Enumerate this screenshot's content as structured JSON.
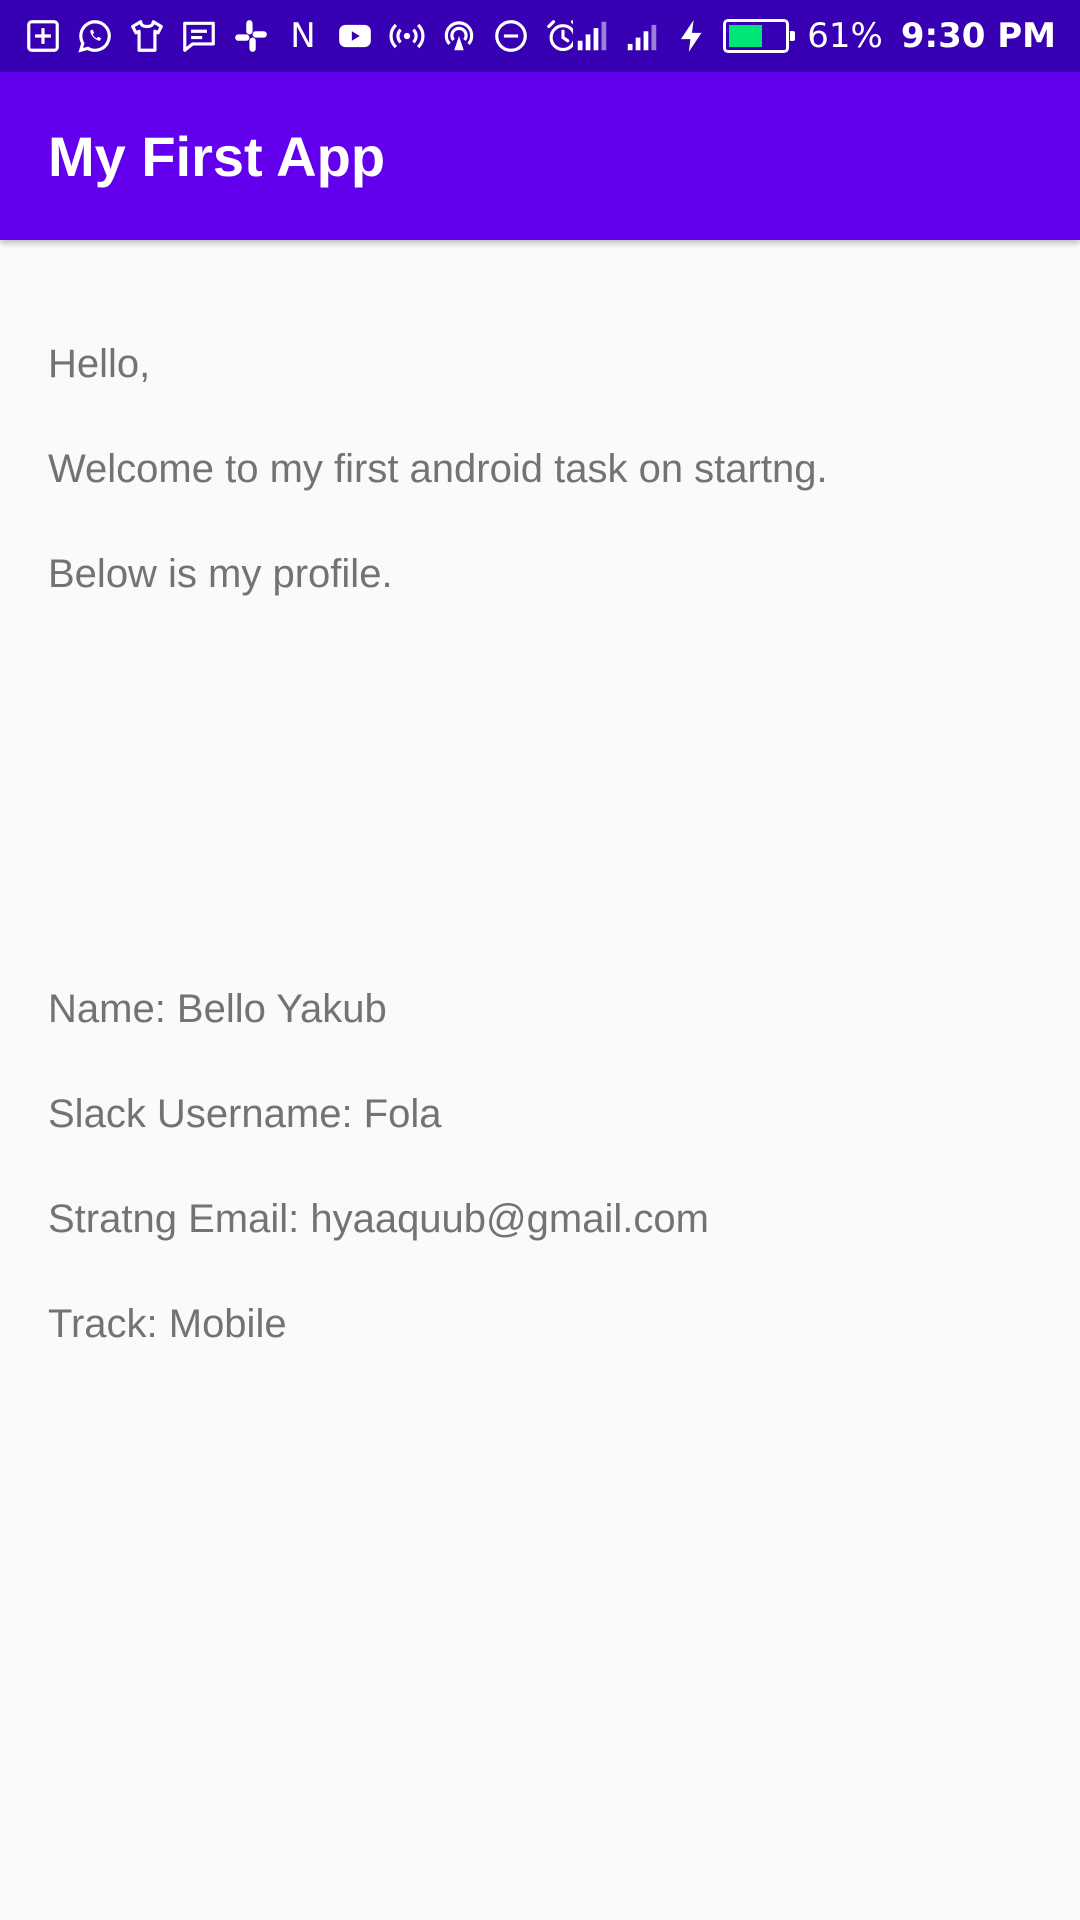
{
  "status_bar": {
    "icons_left": [
      "plus-box-icon",
      "whatsapp-icon",
      "tshirt-icon",
      "message-icon",
      "slack-icon",
      "n-letter-icon",
      "youtube-icon",
      "hotspot-icon",
      "airplay-icon",
      "do-not-disturb-icon",
      "alarm-icon"
    ],
    "n_letter": "N",
    "battery_level": 0.61,
    "battery_percent": "61%",
    "time": "9:30 PM",
    "battery_color": "#00e676"
  },
  "app_bar": {
    "title": "My First App",
    "color": "#6200ee"
  },
  "greeting": {
    "hello": "Hello,",
    "welcome": "Welcome to my first android task on startng.",
    "below": "Below is my profile."
  },
  "profile": {
    "name": "Name: Bello Yakub",
    "slack": "Slack Username: Fola",
    "email": "Stratng Email: hyaaquub@gmail.com",
    "track": "Track: Mobile"
  }
}
